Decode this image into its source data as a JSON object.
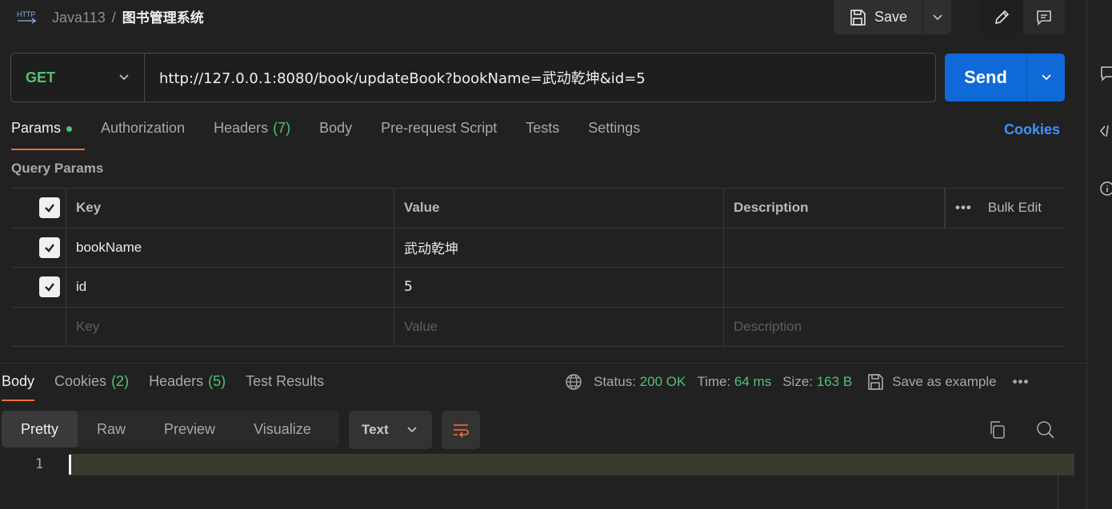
{
  "header": {
    "workspace": "Java113",
    "separator": "/",
    "request_name": "图书管理系统",
    "save_label": "Save",
    "protocol_icon": "http-icon"
  },
  "request": {
    "method": "GET",
    "url": "http://127.0.0.1:8080/book/updateBook?bookName=武动乾坤&id=5",
    "send_label": "Send"
  },
  "request_tabs": [
    {
      "label": "Params",
      "active": true
    },
    {
      "label": "Authorization"
    },
    {
      "label": "Headers",
      "count": "(7)"
    },
    {
      "label": "Body"
    },
    {
      "label": "Pre-request Script"
    },
    {
      "label": "Tests"
    },
    {
      "label": "Settings"
    }
  ],
  "cookies_link": "Cookies",
  "query_params": {
    "title": "Query Params",
    "columns": {
      "key": "Key",
      "value": "Value",
      "description": "Description",
      "bulk_edit": "Bulk Edit"
    },
    "rows": [
      {
        "key": "bookName",
        "value": "武动乾坤",
        "checked": true
      },
      {
        "key": "id",
        "value": "5",
        "checked": true
      }
    ],
    "placeholders": {
      "key": "Key",
      "value": "Value",
      "description": "Description"
    }
  },
  "response_tabs": [
    {
      "label": "Body",
      "active": true
    },
    {
      "label": "Cookies",
      "count": "(2)"
    },
    {
      "label": "Headers",
      "count": "(5)"
    },
    {
      "label": "Test Results"
    }
  ],
  "response_status": {
    "status_label": "Status:",
    "status_value": "200 OK",
    "time_label": "Time:",
    "time_value": "64 ms",
    "size_label": "Size:",
    "size_value": "163 B",
    "save_example": "Save as example"
  },
  "format_tabs": [
    "Pretty",
    "Raw",
    "Preview",
    "Visualize"
  ],
  "response_type": "Text",
  "editor": {
    "line_number": "1"
  },
  "colors": {
    "accent": "#ff6c37",
    "send": "#0f6ad8",
    "success": "#4fc373",
    "link": "#3d94ff"
  }
}
